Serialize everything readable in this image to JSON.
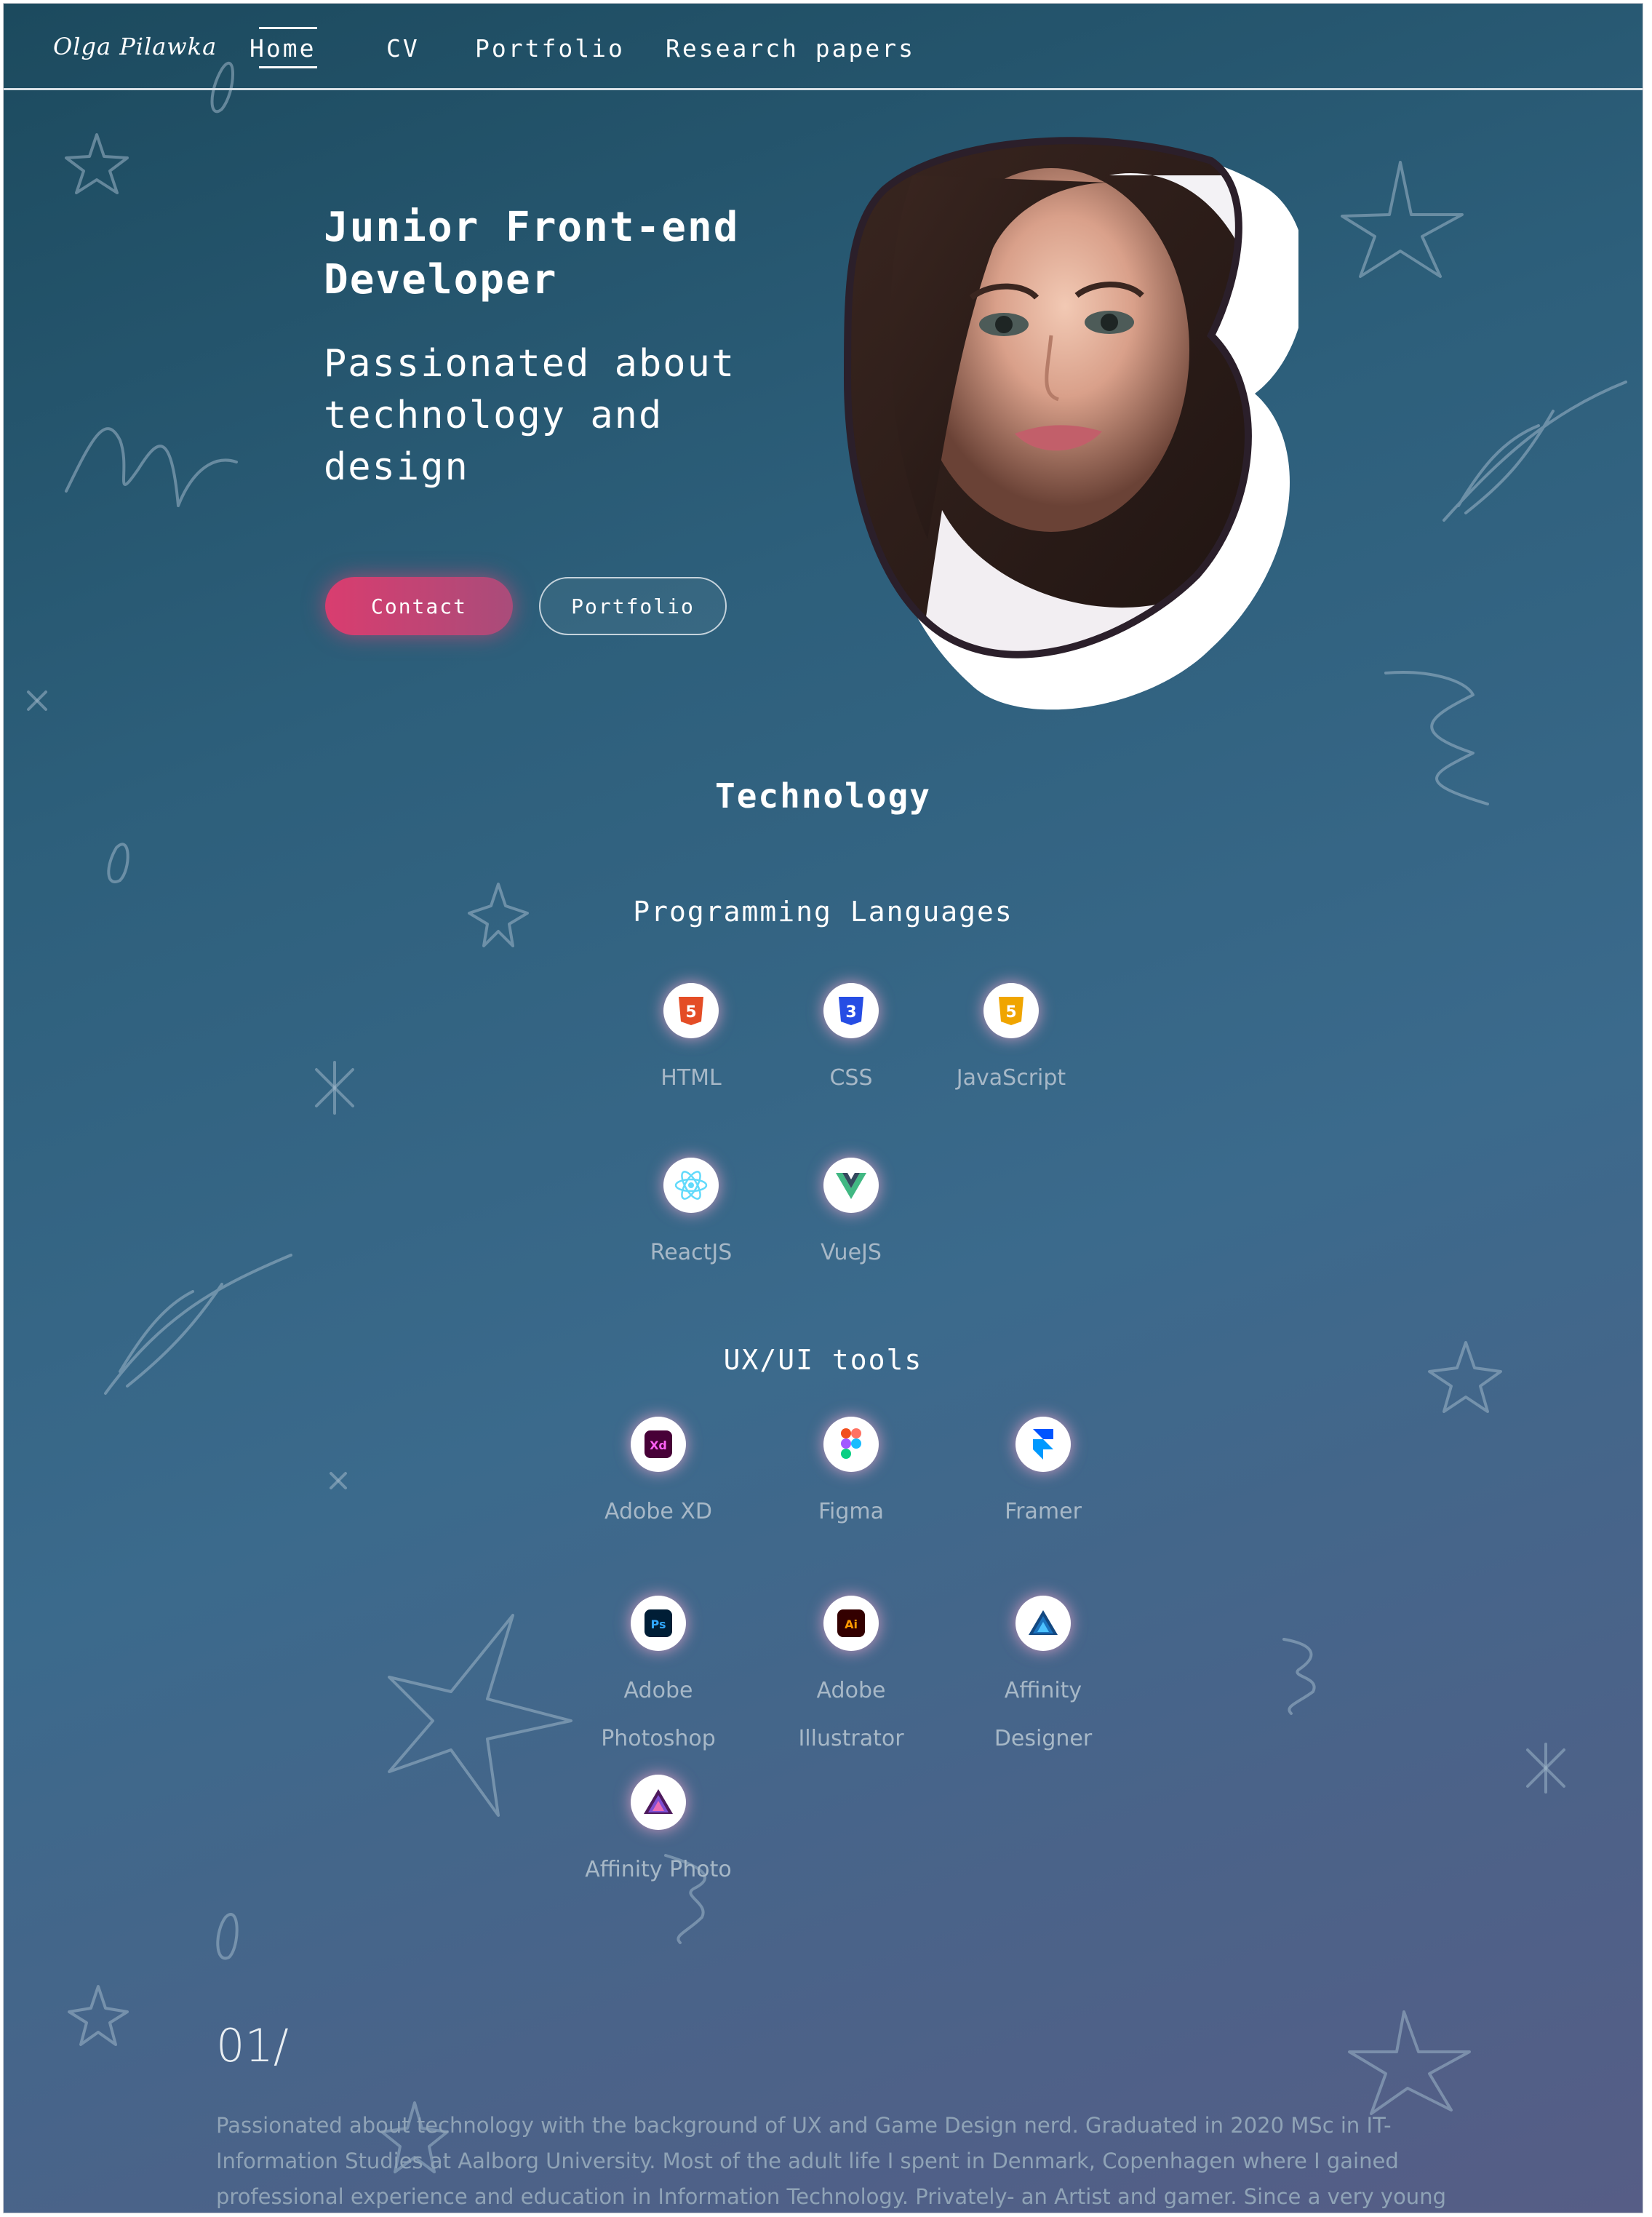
{
  "nav": {
    "logo": "Olga Pilawka",
    "links": [
      "Home",
      "CV",
      "Portfolio",
      "Research papers"
    ],
    "active": "Home"
  },
  "hero": {
    "title": "Junior Front-end Developer",
    "subtitle": "Passionated about technology and design",
    "contact_label": "Contact",
    "portfolio_label": "Portfolio"
  },
  "technology": {
    "title": "Technology",
    "programming_title": "Programming Languages",
    "programming": [
      {
        "label": "HTML",
        "icon": "html5-icon"
      },
      {
        "label": "CSS",
        "icon": "css3-icon"
      },
      {
        "label": "JavaScript",
        "icon": "javascript-icon"
      },
      {
        "label": "ReactJS",
        "icon": "react-icon"
      },
      {
        "label": "VueJS",
        "icon": "vue-icon"
      }
    ],
    "ux_title": "UX/UI tools",
    "ux": [
      {
        "label": "Adobe XD",
        "icon": "adobe-xd-icon"
      },
      {
        "label": "Figma",
        "icon": "figma-icon"
      },
      {
        "label": "Framer",
        "icon": "framer-icon"
      },
      {
        "label": "Adobe Photoshop",
        "icon": "photoshop-icon"
      },
      {
        "label": "Adobe Illustrator",
        "icon": "illustrator-icon"
      },
      {
        "label": "Affinity Designer",
        "icon": "affinity-designer-icon"
      },
      {
        "label": "Affinity Photo",
        "icon": "affinity-photo-icon"
      }
    ]
  },
  "intro": {
    "number": "01/",
    "text": "Passionated about technology with the background of UX and Game Design nerd. Graduated in 2020 MSc in IT- Information Studies at Aalborg University. Most of the adult life I spent in Denmark, Copenhagen where I gained professional experience and education in Information Technology. Privately- an Artist and gamer. Since a very young age passionated about painting and art."
  },
  "colors": {
    "contact_button": "#d93d6f",
    "background_top": "#1c4a5e",
    "background_bottom": "#565d86"
  }
}
